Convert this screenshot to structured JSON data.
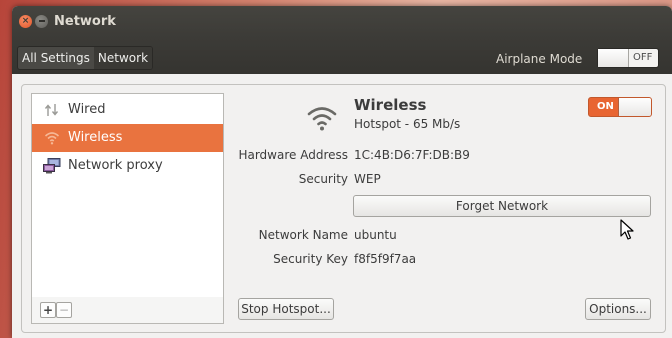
{
  "window": {
    "title": "Network"
  },
  "toolbar": {
    "breadcrumbs": [
      "All Settings",
      "Network"
    ],
    "airplane_mode_label": "Airplane Mode",
    "airplane_mode_state": "OFF"
  },
  "sidebar": {
    "items": [
      {
        "label": "Wired",
        "icon": "wired-arrows-icon"
      },
      {
        "label": "Wireless",
        "icon": "wifi-icon",
        "selected": true
      },
      {
        "label": "Network proxy",
        "icon": "network-proxy-icon"
      }
    ],
    "add_label": "+",
    "remove_label": "−"
  },
  "detail": {
    "name": "Wireless",
    "status": "Hotspot - 65 Mb/s",
    "power_state": "ON",
    "hardware_address_label": "Hardware Address",
    "hardware_address": "1C:4B:D6:7F:DB:B9",
    "security_label": "Security",
    "security": "WEP",
    "forget_button": "Forget Network",
    "network_name_label": "Network Name",
    "network_name": "ubuntu",
    "security_key_label": "Security Key",
    "security_key": "f8f5f9f7aa",
    "stop_hotspot_button": "Stop Hotspot...",
    "options_button": "Options..."
  },
  "colors": {
    "accent": "#e9733f",
    "titlebar": "#3c3b37",
    "window_bg": "#f2f1f0"
  }
}
